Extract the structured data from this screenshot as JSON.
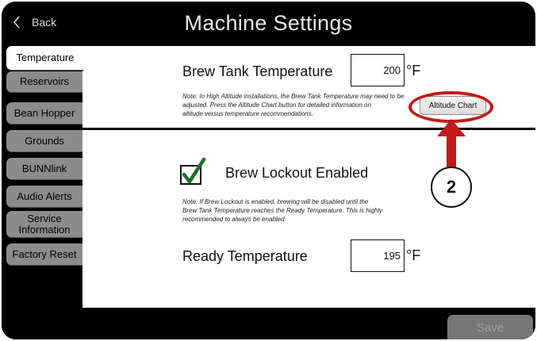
{
  "header": {
    "back_label": "Back",
    "title": "Machine Settings"
  },
  "tabs": [
    {
      "label": "Temperature",
      "active": true
    },
    {
      "label": "Reservoirs",
      "active": false
    },
    {
      "label": "Bean Hopper",
      "active": false
    },
    {
      "label": "Grounds",
      "active": false
    },
    {
      "label": "BUNNlink",
      "active": false
    },
    {
      "label": "Audio Alerts",
      "active": false
    },
    {
      "label": "Service Information",
      "active": false
    },
    {
      "label": "Factory Reset",
      "active": false
    }
  ],
  "brew_tank": {
    "label": "Brew Tank Temperature",
    "value": "200",
    "unit": "°F",
    "note_line1": "Note:  In High Altitude installations, the Brew Tank Temperature may need to be",
    "note_line2": "adjusted.  Press the Altitude Chart button for detailed information on",
    "note_line3": "altitude versus temperature recommendations.",
    "altitude_button": "Altitude Chart"
  },
  "lockout": {
    "label": "Brew Lockout Enabled",
    "checked": true,
    "note_line1": "Note:  If Brew Lockout is enabled, brewing will be disabled until the",
    "note_line2": "Brew Tank Temperature reaches the Ready Temperature. This is highly",
    "note_line3": "recommended to always be enabled."
  },
  "ready": {
    "label": "Ready Temperature",
    "value": "195",
    "unit": "°F"
  },
  "footer": {
    "save_label": "Save"
  },
  "annotation": {
    "badge": "2",
    "color": "#c21a1a"
  },
  "colors": {
    "check": "#1b6e2a",
    "tab_inactive": "#8c8c8c"
  }
}
